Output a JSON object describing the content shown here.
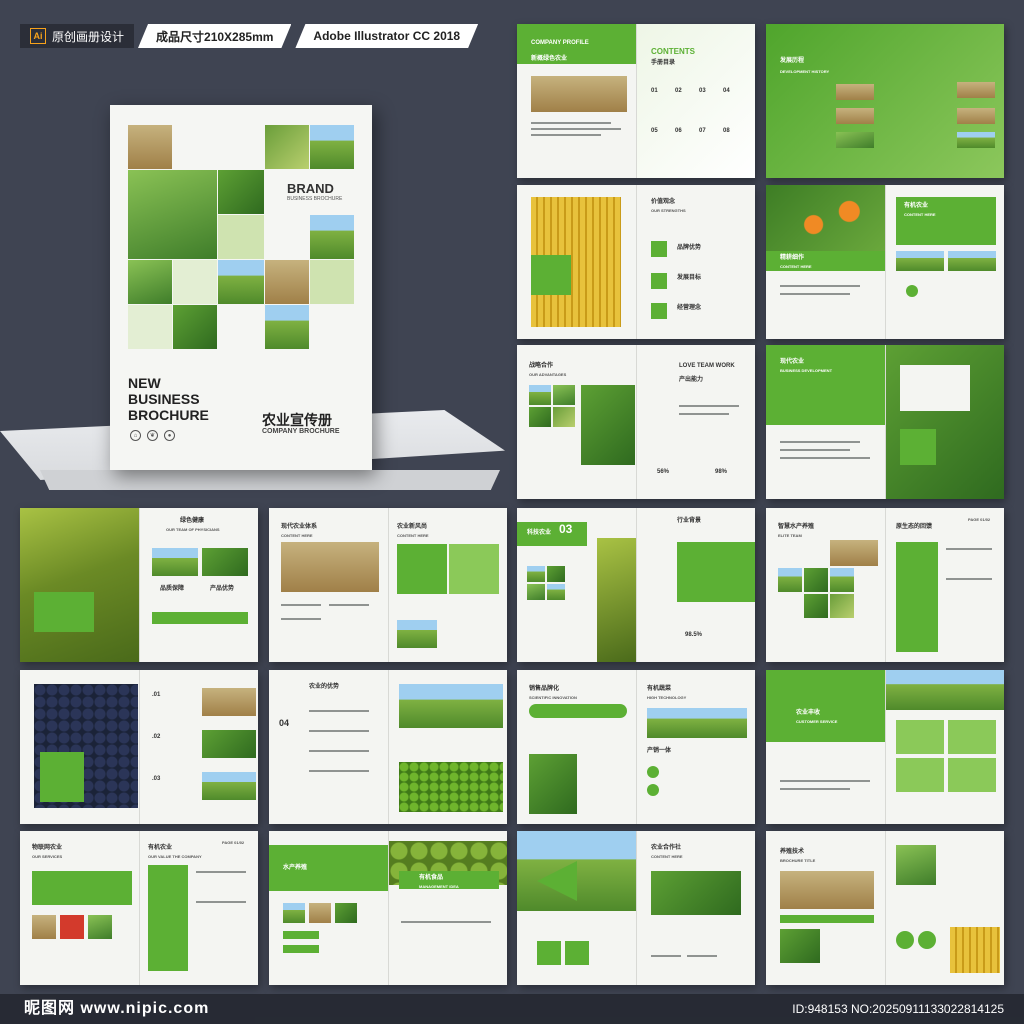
{
  "top_tags": {
    "design_label": "原创画册设计",
    "ai_badge": "Ai",
    "size_label": "成品尺寸210X285mm",
    "software_label": "Adobe Illustrator CC 2018"
  },
  "cover": {
    "brand": "BRAND",
    "brand_sub": "BUSINESS BROCHURE",
    "title_line1": "NEW",
    "title_line2": "BUSINESS",
    "title_line3": "BROCHURE",
    "title_cn": "农业宣传册",
    "title_en": "COMPANY BROCHURE"
  },
  "spreads": {
    "s1": {
      "left_h": "COMPANY PROFILE",
      "left_sub": "新概绿色农业",
      "right_h": "CONTENTS",
      "right_sub": "手册目录",
      "nums": [
        "01",
        "02",
        "03",
        "04",
        "05",
        "06",
        "07",
        "08"
      ]
    },
    "s2": {
      "h": "发展历程",
      "sub": "DEVELOPMENT HISTORY"
    },
    "s3": {
      "h": "价值观念",
      "sub": "OUR STRENGTHS",
      "items": [
        "品牌优势",
        "发展目标",
        "经营理念"
      ]
    },
    "s4": {
      "h": "有机农业",
      "sub": "CONTENT HERE",
      "left": "精耕细作",
      "left_sub": "CONTENT HERE"
    },
    "s5": {
      "h": "战略合作",
      "sub": "OUR ADVANTAGES",
      "right_h": "LOVE TEAM WORK",
      "right_sub": "产出能力",
      "p1": "56%",
      "p2": "98%"
    },
    "s6": {
      "h": "现代农业",
      "sub": "BUSINESS DEVELOPMENT"
    },
    "s7": {
      "h": "绿色健康",
      "sub": "OUR TEAM OF PHYSICIANS",
      "items": [
        "品质保障",
        "产品优势"
      ]
    },
    "s8": {
      "h": "现代农业体系",
      "sub": "CONTENT HERE",
      "right_h": "农业新风尚",
      "right_sub": "CONTENT HERE"
    },
    "s9": {
      "h": "科技农业",
      "num": "03",
      "right_h": "行业背景",
      "pct": "98.5%"
    },
    "s10": {
      "h": "智慧水产养殖",
      "sub": "ELITE TEAM",
      "right_h": "原生态的回馈",
      "page": "PAGE 01/02"
    },
    "s11": {
      "nums": [
        ".01",
        ".02",
        ".03"
      ]
    },
    "s12": {
      "h": "农业的优势",
      "num": "04"
    },
    "s13": {
      "h": "销售品牌化",
      "sub": "SCIENTIFIC INNOVATION",
      "right_h": "有机蔬菜",
      "right_sub": "HIGH TECHNOLOGY",
      "right_h2": "产销一体"
    },
    "s14": {
      "h": "农业丰收",
      "sub": "CUSTOMER SERVICE"
    },
    "s15": {
      "h": "物联网农业",
      "sub": "OUR SERVICES",
      "right_h": "有机农业",
      "right_sub": "OUR VALUE THE COMPANY",
      "page": "PAGE 01/02"
    },
    "s16": {
      "h": "水产养殖",
      "right_h": "有机食品",
      "right_sub": "MANAGEMENT IDEA"
    },
    "s17": {
      "h": "农业合作社",
      "sub": "CONTENT HERE"
    },
    "s18": {
      "h": "养殖技术",
      "sub": "BROCHURE TITLE"
    }
  },
  "watermark": {
    "logo": "昵图网 www.nipic.com",
    "id_text": "ID:948153 NO:20250911133022814125"
  },
  "colors": {
    "accent": "#5cb034",
    "background": "#3f4452",
    "paper": "#f4f5f2"
  }
}
